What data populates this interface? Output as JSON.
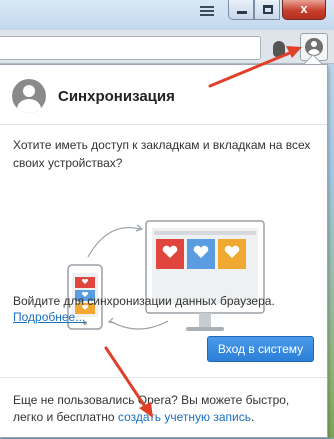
{
  "window": {
    "close_label": "x"
  },
  "panel": {
    "title": "Синхронизация",
    "question": "Хотите иметь доступ к закладкам и вкладкам на всех своих устройствах?",
    "signin_text": "Войдите для синхронизации данных браузера.",
    "more_link": "Подробнее...",
    "signin_button": "Вход в систему",
    "footer_text": "Еще не пользовались Opera? Вы можете быстро, легко и бесплатно ",
    "footer_link": "создать учетную запись",
    "footer_end": "."
  },
  "colors": {
    "accent": "#2c7fd8",
    "link": "#1a6fbf",
    "annotation_arrow": "#e0402a",
    "heart_red": "#e0463e",
    "heart_blue": "#5a9ce0",
    "heart_orange": "#f0a830"
  },
  "icons": {
    "account": "person-icon",
    "extension": "hand-icon",
    "menu": "stack-icon"
  }
}
